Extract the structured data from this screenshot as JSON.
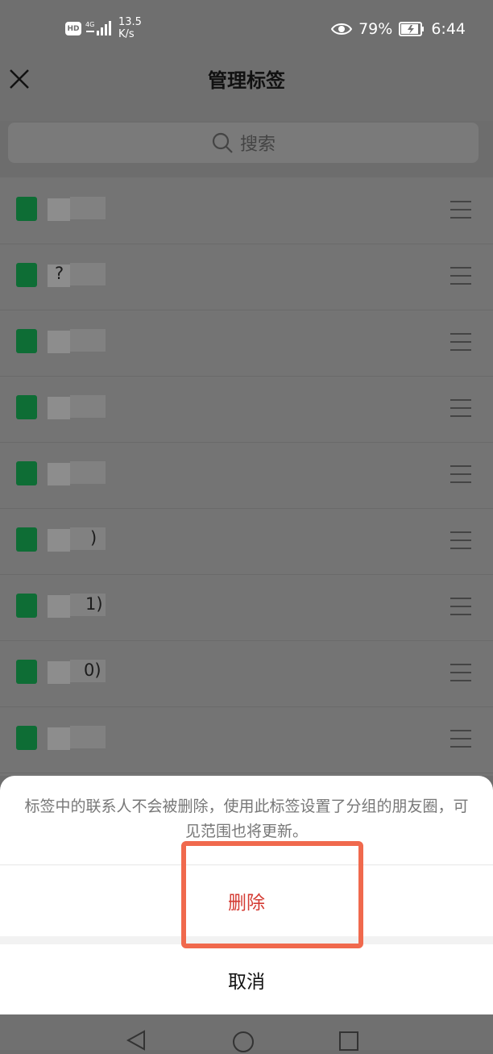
{
  "status_bar": {
    "hd_label": "HD",
    "network": "4G",
    "net_speed_value": "13.5",
    "net_speed_unit": "K/s",
    "battery_percent": "79%",
    "time": "6:44"
  },
  "header": {
    "title": "管理标签"
  },
  "search": {
    "placeholder": "搜索"
  },
  "tags": [
    {
      "name": "",
      "color": "#0e6d35"
    },
    {
      "name": "?",
      "color": "#0e6d35"
    },
    {
      "name": "",
      "color": "#0e6d35"
    },
    {
      "name": "",
      "color": "#0e6d35"
    },
    {
      "name": "",
      "color": "#0e6d35"
    },
    {
      "name": ")",
      "color": "#0e6d35"
    },
    {
      "name": "1)",
      "color": "#0e6d35"
    },
    {
      "name": "0)",
      "color": "#0e6d35"
    },
    {
      "name": "",
      "color": "#0e6d35"
    }
  ],
  "sheet": {
    "message": "标签中的联系人不会被删除，使用此标签设置了分组的朋友圈，可见范围也将更新。",
    "delete_label": "删除",
    "cancel_label": "取消",
    "delete_color": "#d43b33",
    "highlight_color": "#f0694d"
  },
  "icons": {
    "close": "close-icon",
    "search": "search-icon",
    "drag": "drag-handle-icon",
    "back": "back-icon",
    "home": "home-icon",
    "recent": "recent-apps-icon"
  }
}
